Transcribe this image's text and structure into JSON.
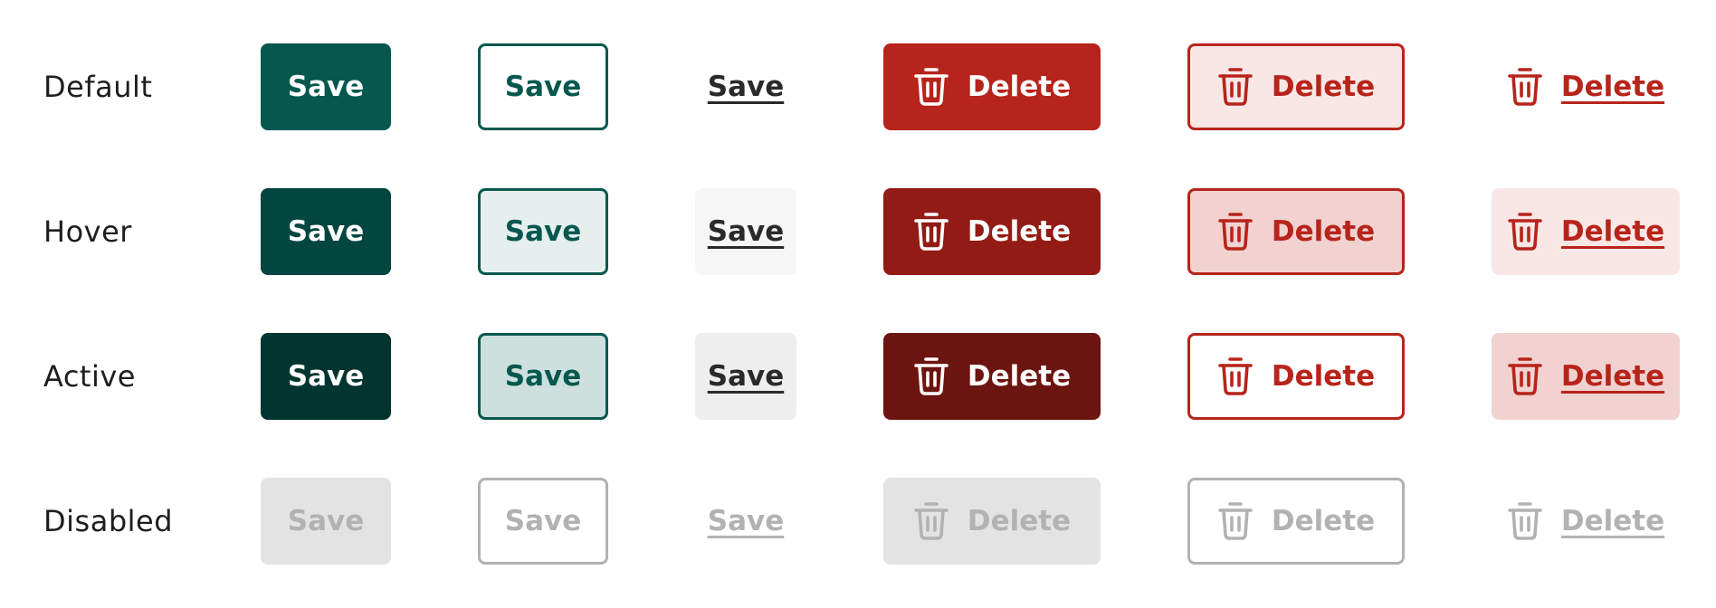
{
  "states": [
    {
      "label": "Default"
    },
    {
      "label": "Hover"
    },
    {
      "label": "Active"
    },
    {
      "label": "Disabled"
    }
  ],
  "buttons": {
    "save_label": "Save",
    "delete_label": "Delete",
    "delete_icon": "trash-icon"
  },
  "colors": {
    "primary_default": "#06584f",
    "primary_hover": "#03463f",
    "primary_active": "#023530",
    "danger_default": "#b7241b",
    "danger_hover": "#921b15",
    "danger_active": "#6c140f",
    "disabled_fill": "#e3e3e3",
    "disabled_text": "#b2b2b2",
    "link_text": "#2a2a2a"
  }
}
